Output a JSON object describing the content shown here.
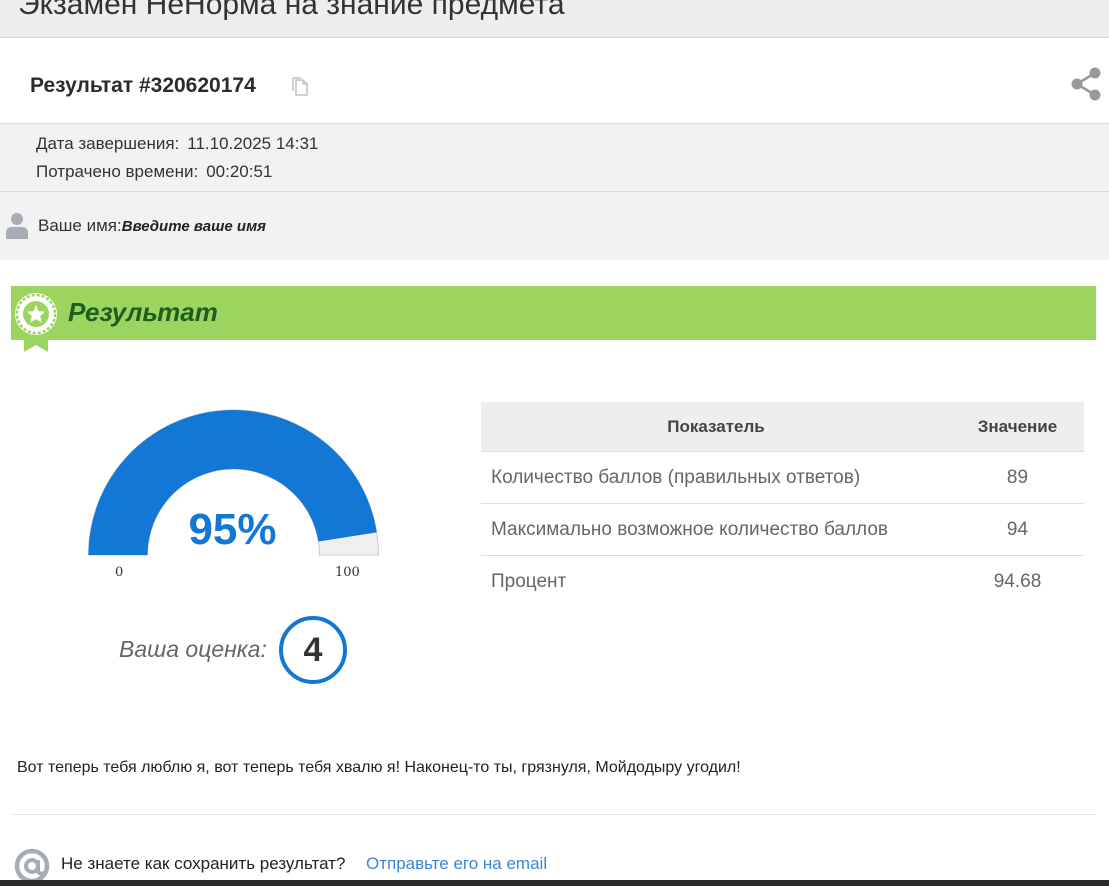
{
  "exam": {
    "title": "Экзамен НеНорма на знание предмета"
  },
  "result": {
    "id_label": "Результат #320620174"
  },
  "meta": {
    "completion_label": "Дата завершения:",
    "completion_value": "11.10.2025 14:31",
    "time_label": "Потрачено времени:",
    "time_value": "00:20:51"
  },
  "name": {
    "label": "Ваше имя:",
    "placeholder": "Введите ваше имя"
  },
  "banner": {
    "title": "Результат"
  },
  "gauge": {
    "value_label": "95%",
    "value": 95,
    "min": "0",
    "max": "100",
    "fill_color": "#1377d5",
    "track_color": "#efefef"
  },
  "grade": {
    "label": "Ваша оценка:",
    "value": "4"
  },
  "table": {
    "headers": [
      "Показатель",
      "Значение"
    ],
    "rows": [
      {
        "label": "Количество баллов (правильных ответов)",
        "value": "89"
      },
      {
        "label": "Максимально возможное количество баллов",
        "value": "94"
      },
      {
        "label": "Процент",
        "value": "94.68"
      }
    ]
  },
  "message": "Вот теперь тебя люблю я, вот теперь тебя хвалю я! Наконец-то ты, грязнуля, Мойдодыру угодил!",
  "footer": {
    "question": "Не знаете как сохранить результат?",
    "link": "Отправьте его на email"
  },
  "colors": {
    "banner": "#9bd55f",
    "banner_text": "#1e5e1e",
    "accent": "#1377d5",
    "link": "#3a86d6"
  },
  "icons": [
    "copy-icon",
    "share-icon",
    "user-icon",
    "award-badge-icon",
    "at-sign-icon"
  ]
}
